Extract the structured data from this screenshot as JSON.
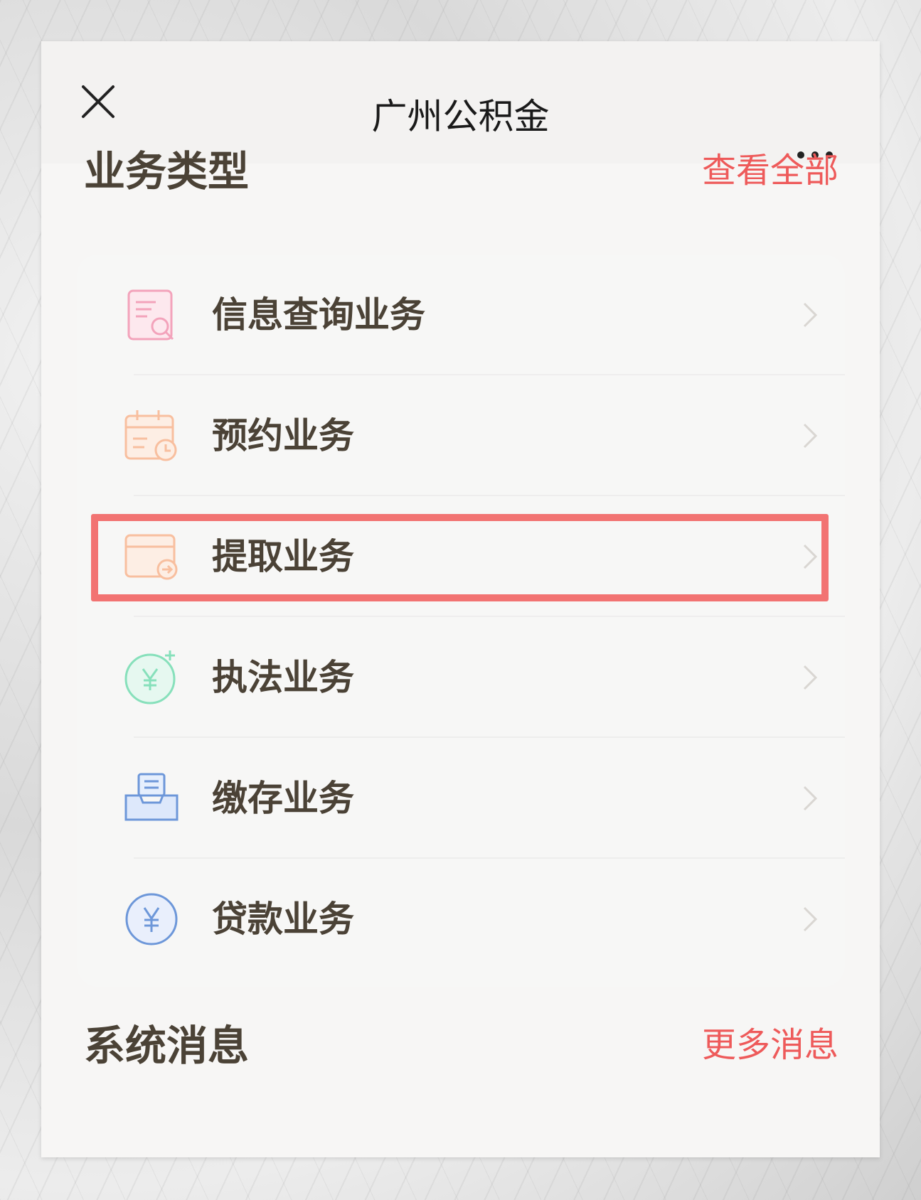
{
  "header": {
    "title": "广州公积金"
  },
  "business_section": {
    "title": "业务类型",
    "view_all_label": "查看全部"
  },
  "business_items": [
    {
      "label": "信息查询业务",
      "icon": "document-search-icon"
    },
    {
      "label": "预约业务",
      "icon": "calendar-clock-icon"
    },
    {
      "label": "提取业务",
      "icon": "card-withdraw-icon"
    },
    {
      "label": "执法业务",
      "icon": "yuan-sparkle-icon"
    },
    {
      "label": "缴存业务",
      "icon": "inbox-tray-icon"
    },
    {
      "label": "贷款业务",
      "icon": "yuan-circle-icon"
    }
  ],
  "messages_section": {
    "title": "系统消息",
    "more_label": "更多消息"
  },
  "colors": {
    "accent_red": "#ee5a5a",
    "highlight_border": "#f27372",
    "text_brown": "#4b4236"
  }
}
